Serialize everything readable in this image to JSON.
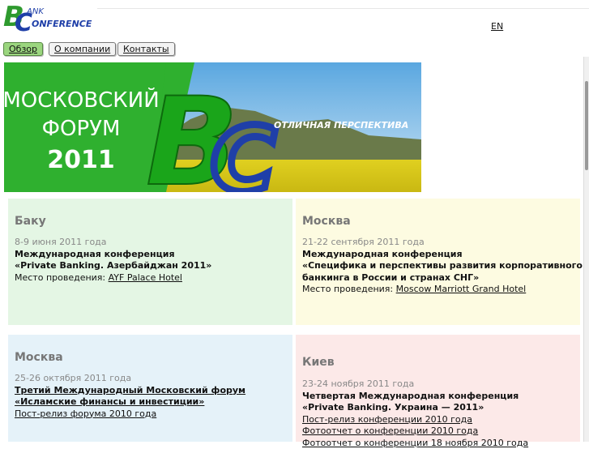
{
  "logo": {
    "letters": "BC",
    "word1": "ANK",
    "word2": "ONFERENCE"
  },
  "lang": "EN",
  "nav": {
    "tabs": [
      "Обзор",
      "О компании",
      "Контакты"
    ]
  },
  "banner": {
    "line1": "МОСКОВСКИЙ",
    "line2": "ФОРУМ",
    "line3": "2011",
    "tagline": "ОТЛИЧНАЯ ПЕРСПЕКТИВА",
    "logo_letters": "BC"
  },
  "events": [
    {
      "city": "Баку",
      "date": "8-9 июня 2011 года",
      "title1": "Международная конференция",
      "title2": "«Private Banking. Азербайджан 2011»",
      "venue_label": "Место проведения: ",
      "venue": "AYF Palace Hotel"
    },
    {
      "city": "Москва",
      "date": "21-22 сентября 2011 года",
      "title1": "Международная конференция",
      "title2": "«Специфика и перспективы развития корпоративного",
      "title3": "банкинга в России и странах СНГ»",
      "venue_label": "Место проведения: ",
      "venue": "Moscow Marriott Grand Hotel"
    },
    {
      "city": "Москва",
      "date": "25-26 октября 2011 года",
      "title1": "Третий Международный Московский форум",
      "title2": "«Исламские финансы и инвестиции»",
      "link1": "Пост-релиз форума 2010 года"
    },
    {
      "city": "Киев",
      "date": "23-24 ноября 2011 года",
      "title1": "Четвертая Международная конференция",
      "title2": "«Private Banking. Украина — 2011»",
      "link1": "Пост-релиз конференции 2010 года",
      "link2": "Фотоотчет о конференции 2010 года",
      "link3": "Фотоотчет о конференции 18 ноября 2010 года"
    }
  ],
  "colors": {
    "banner_green": "#2fb02f",
    "active_tab": "#9bd67f",
    "logo_green": "#2e9a2e",
    "logo_blue": "#1f3fa8"
  }
}
